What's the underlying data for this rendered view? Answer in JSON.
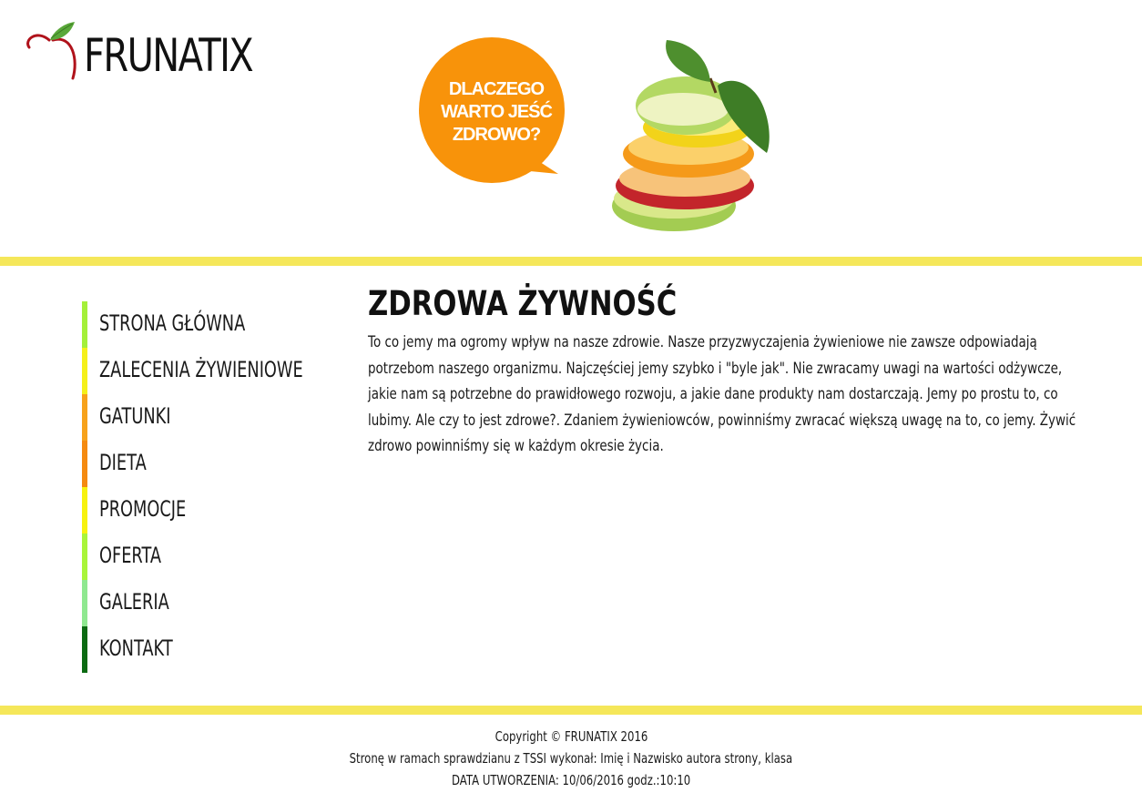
{
  "header": {
    "logo_text": "FRUNATIX",
    "logo_icon": "apple-leaf-icon",
    "banner": {
      "bubble_lines": [
        "DLACZEGO",
        "WARTO JEŚĆ",
        "ZDROWO?"
      ],
      "bubble_color": "#f8930a",
      "image": "stacked-fruit-slices"
    }
  },
  "accent_stripe_color": "#f5e75a",
  "nav": {
    "items": [
      {
        "label": "STRONA GŁÓWNA",
        "color": "#a4f03a"
      },
      {
        "label": "ZALECENIA ŻYWIENIOWE",
        "color": "#f5f01a"
      },
      {
        "label": "GATUNKI",
        "color": "#f7a21b"
      },
      {
        "label": "DIETA",
        "color": "#f58a10"
      },
      {
        "label": "PROMOCJE",
        "color": "#f7f20e"
      },
      {
        "label": "OFERTA",
        "color": "#a9f53a"
      },
      {
        "label": "GALERIA",
        "color": "#8fe890"
      },
      {
        "label": "KONTAKT",
        "color": "#0b6a12"
      }
    ]
  },
  "main": {
    "title": "ZDROWA ŻYWNOŚĆ",
    "body": "To co jemy ma ogromy wpływ na nasze zdrowie. Nasze przyzwyczajenia żywieniowe nie zawsze odpowiadają potrzebom naszego organizmu. Najczęściej jemy szybko i \"byle jak\". Nie zwracamy uwagi na wartości odżywcze, jakie nam są potrzebne do prawidłowego rozwoju, a jakie dane produkty nam dostarczają. Jemy po prostu to, co lubimy. Ale czy to jest zdrowe?. Zdaniem żywieniowców, powinniśmy zwracać większą uwagę na to, co jemy. Żywić zdrowo powinniśmy się w każdym okresie życia."
  },
  "footer": {
    "copyright": "Copyright © FRUNATIX 2016",
    "author": "Stronę w ramach sprawdzianu z TSSI wykonał: Imię i Nazwisko autora strony, klasa",
    "created": "DATA UTWORZENIA: 10/06/2016 godz.:10:10"
  }
}
